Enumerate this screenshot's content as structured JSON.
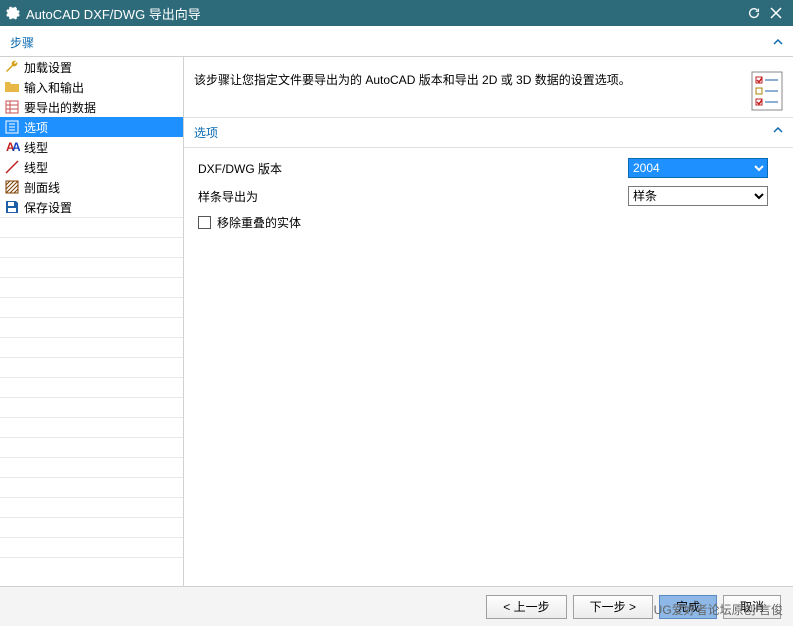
{
  "title": "AutoCAD DXF/DWG 导出向导",
  "steps_label": "步骤",
  "sidebar": {
    "items": [
      {
        "label": "加载设置"
      },
      {
        "label": "输入和输出"
      },
      {
        "label": "要导出的数据"
      },
      {
        "label": "选项"
      },
      {
        "label": "线型"
      },
      {
        "label": "线型"
      },
      {
        "label": "剖面线"
      },
      {
        "label": "保存设置"
      }
    ]
  },
  "description": "该步骤让您指定文件要导出为的 AutoCAD 版本和导出 2D 或 3D 数据的设置选项。",
  "panel_title": "选项",
  "fields": {
    "version_label": "DXF/DWG 版本",
    "version_value": "2004",
    "spline_label": "样条导出为",
    "spline_value": "样条",
    "remove_dup_label": "移除重叠的实体"
  },
  "buttons": {
    "prev": "< 上一步",
    "next": "下一步 >",
    "finish": "完成",
    "cancel": "取消"
  },
  "watermark": "UG爱好者论坛原创 言俊"
}
